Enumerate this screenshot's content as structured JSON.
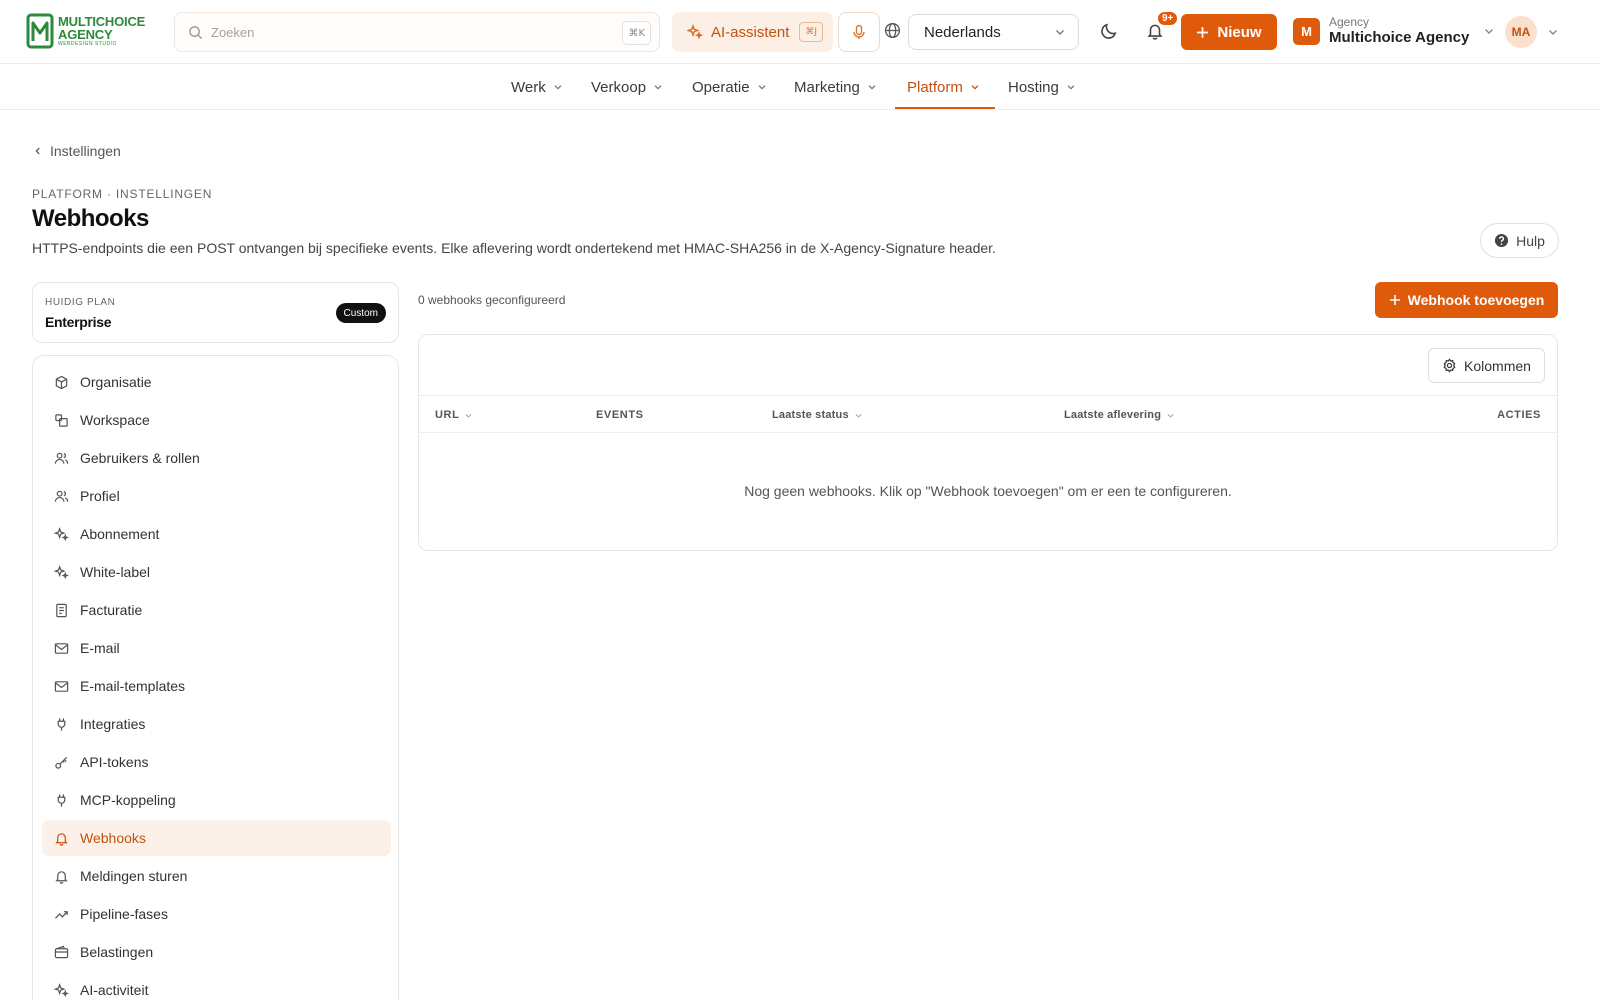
{
  "brand": {
    "line1": "MULTICHOICE",
    "line2": "AGENCY",
    "line3": "WEBDESIGN STUDIO",
    "accent": "#e05a0c",
    "logo_green": "#2d8a3a"
  },
  "header": {
    "search_placeholder": "Zoeken",
    "search_shortcut": "⌘K",
    "ai_label": "AI-assistent",
    "ai_shortcut": "⌘J",
    "language": "Nederlands",
    "notification_badge": "9+",
    "new_button": "Nieuw",
    "agency_sub": "Agency",
    "agency_name": "Multichoice Agency",
    "agency_initial": "M",
    "user_initials": "MA"
  },
  "nav": {
    "items": [
      {
        "label": "Werk"
      },
      {
        "label": "Verkoop"
      },
      {
        "label": "Operatie"
      },
      {
        "label": "Marketing"
      },
      {
        "label": "Platform"
      },
      {
        "label": "Hosting"
      }
    ],
    "active": "Platform"
  },
  "page": {
    "back_label": "Instellingen",
    "eyebrow": "PLATFORM · INSTELLINGEN",
    "title": "Webhooks",
    "description": "HTTPS-endpoints die een POST ontvangen bij specifieke events. Elke aflevering wordt ondertekend met HMAC-SHA256 in de X-Agency-Signature header.",
    "help_label": "Hulp"
  },
  "plan": {
    "label": "HUIDIG PLAN",
    "name": "Enterprise",
    "badge": "Custom"
  },
  "sidebar": {
    "items": [
      {
        "label": "Organisatie",
        "icon": "box-icon"
      },
      {
        "label": "Workspace",
        "icon": "workspace-icon"
      },
      {
        "label": "Gebruikers & rollen",
        "icon": "users-icon"
      },
      {
        "label": "Profiel",
        "icon": "users-icon"
      },
      {
        "label": "Abonnement",
        "icon": "sparkle-icon"
      },
      {
        "label": "White-label",
        "icon": "sparkle-icon"
      },
      {
        "label": "Facturatie",
        "icon": "document-icon"
      },
      {
        "label": "E-mail",
        "icon": "mail-icon"
      },
      {
        "label": "E-mail-templates",
        "icon": "mail-icon"
      },
      {
        "label": "Integraties",
        "icon": "plug-icon"
      },
      {
        "label": "API-tokens",
        "icon": "key-icon"
      },
      {
        "label": "MCP-koppeling",
        "icon": "plug-icon"
      },
      {
        "label": "Webhooks",
        "icon": "bell-icon"
      },
      {
        "label": "Meldingen sturen",
        "icon": "bell-icon"
      },
      {
        "label": "Pipeline-fases",
        "icon": "trend-icon"
      },
      {
        "label": "Belastingen",
        "icon": "wallet-icon"
      },
      {
        "label": "AI-activiteit",
        "icon": "sparkle-icon"
      }
    ],
    "active": "Webhooks"
  },
  "main": {
    "count_text": "0 webhooks geconfigureerd",
    "add_button": "Webhook toevoegen",
    "columns_button": "Kolommen",
    "table_headers": [
      "URL",
      "EVENTS",
      "Laatste status",
      "Laatste aflevering",
      "ACTIES"
    ],
    "empty_message": "Nog geen webhooks. Klik op \"Webhook toevoegen\" om er een te configureren."
  }
}
